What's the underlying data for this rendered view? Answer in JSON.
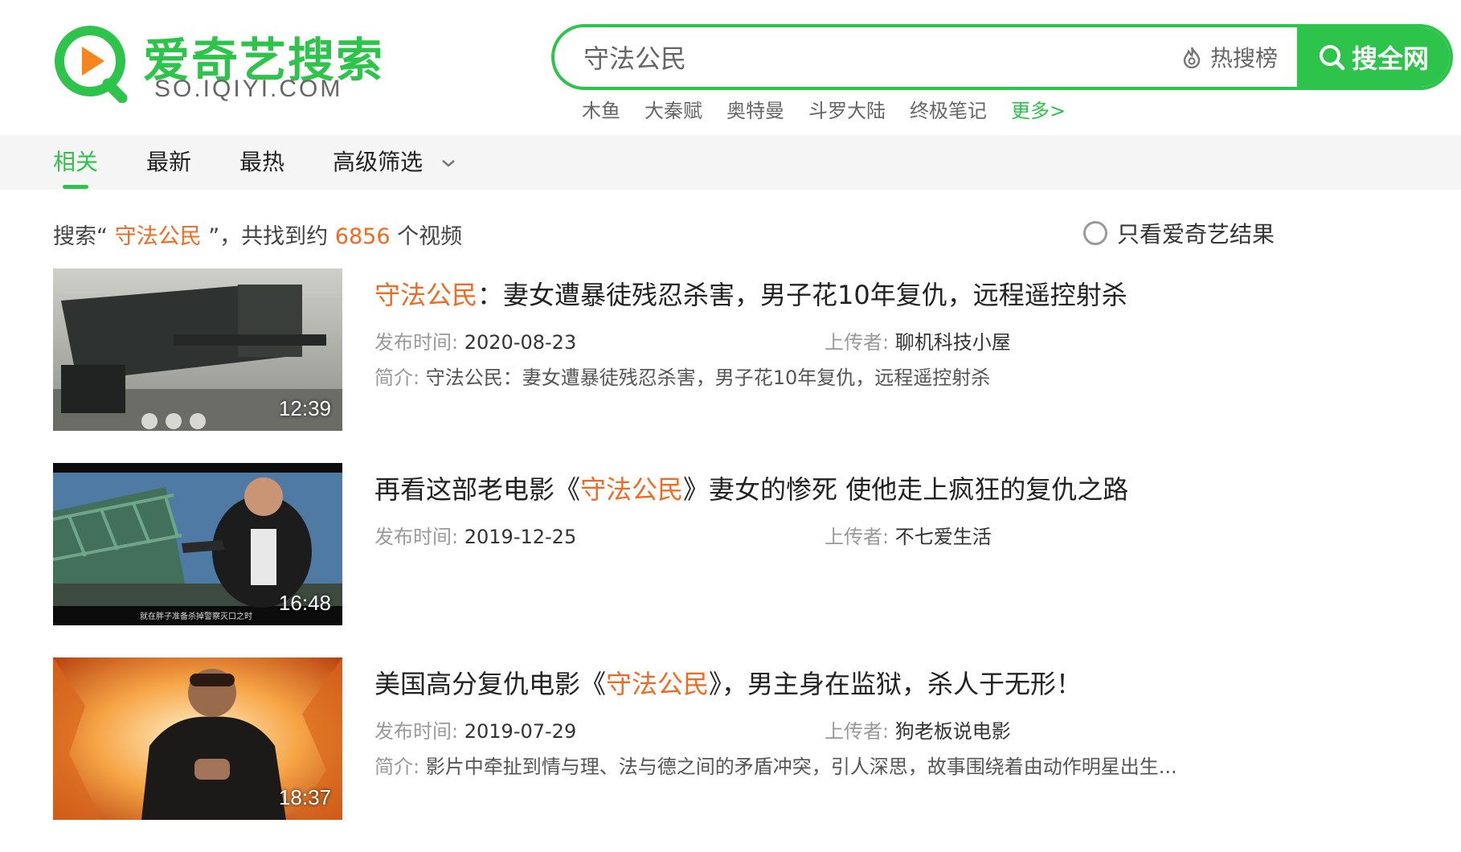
{
  "logo": {
    "name_cn": "爱奇艺搜索",
    "domain": "SO.IQIYI.COM",
    "colors": {
      "brand": "#2ec34a",
      "play": "#f7851e"
    }
  },
  "search": {
    "query": "守法公民",
    "hot_label": "热搜榜",
    "button_label": "搜全网",
    "hot_icon": "fire-icon",
    "button_icon": "search-icon"
  },
  "hotwords": {
    "items": [
      "木鱼",
      "大秦赋",
      "奥特曼",
      "斗罗大陆",
      "终极笔记"
    ],
    "more": "更多>"
  },
  "tabs": {
    "items": [
      "相关",
      "最新",
      "最热",
      "高级筛选"
    ],
    "active": "相关"
  },
  "summary": {
    "prefix": "搜索“",
    "keyword": "守法公民",
    "middle": "”，共找到约",
    "count": "6856",
    "suffix": "个视频"
  },
  "filter": {
    "only_iqiyi": "只看爱奇艺结果",
    "checked": false
  },
  "results": [
    {
      "duration": "12:39",
      "title_before": "",
      "title_highlight": "守法公民",
      "title_after": "：妻女遭暴徒残忍杀害，男子花10年复仇，远程遥控射杀",
      "date_label": "发布时间:",
      "date": "2020-08-23",
      "uploader_label": "上传者:",
      "uploader": "聊机科技小屋",
      "desc_label": "简介:",
      "desc": "守法公民：妻女遭暴徒残忍杀害，男子花10年复仇，远程遥控射杀"
    },
    {
      "duration": "16:48",
      "thumb_caption": "就在胖子准备杀掉警察灭口之时",
      "title_before": "再看这部老电影《",
      "title_highlight": "守法公民",
      "title_after": "》妻女的惨死 使他走上疯狂的复仇之路",
      "date_label": "发布时间:",
      "date": "2019-12-25",
      "uploader_label": "上传者:",
      "uploader": "不七爱生活"
    },
    {
      "duration": "18:37",
      "title_before": "美国高分复仇电影《",
      "title_highlight": "守法公民",
      "title_after": "》，男主身在监狱，杀人于无形！",
      "date_label": "发布时间:",
      "date": "2019-07-29",
      "uploader_label": "上传者:",
      "uploader": "狗老板说电影",
      "desc_label": "简介:",
      "desc": "影片中牵扯到情与理、法与德之间的矛盾冲突，引人深思，故事围绕着由动作明星出生..."
    }
  ]
}
